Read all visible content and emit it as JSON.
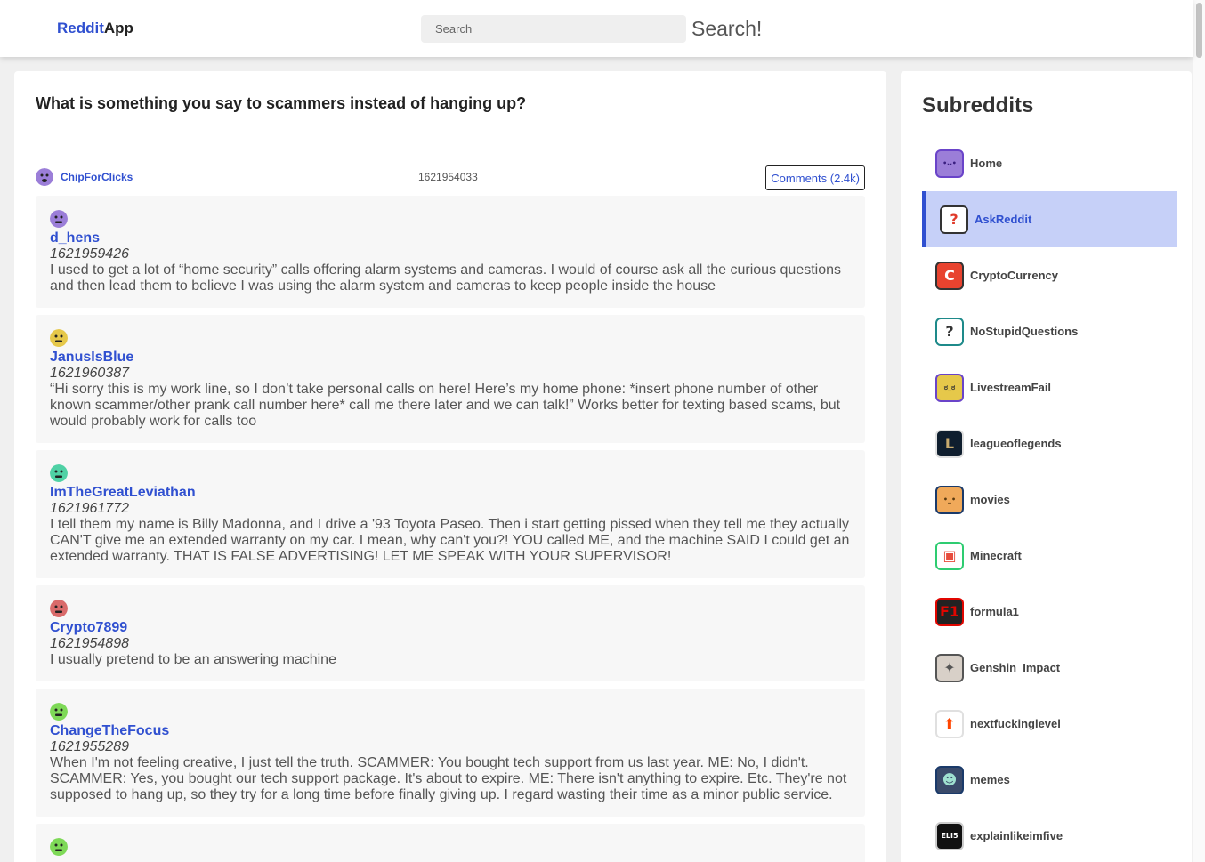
{
  "header": {
    "logo_part1": "Reddit",
    "logo_part2": "App",
    "search_placeholder": "Search",
    "search_button": "Search!"
  },
  "post": {
    "title": "What is something you say to scammers instead of hanging up?",
    "author": "ChipForClicks",
    "timestamp": "1621954033",
    "comments_label": "Comments (2.4k)",
    "author_avatar_color": "#9b7ed8"
  },
  "comments": [
    {
      "author": "d_hens",
      "timestamp": "1621959426",
      "body": "I used to get a lot of “home security” calls offering alarm systems and cameras. I would of course ask all the curious questions and then lead them to believe I was using the alarm system and cameras to keep people inside the house",
      "avatar_color": "#9b7ed8"
    },
    {
      "author": "JanusIsBlue",
      "timestamp": "1621960387",
      "body": "“Hi sorry this is my work line, so I don’t take personal calls on here! Here’s my home phone: *insert phone number of other known scammer/other prank call number here* call me there later and we can talk!” Works better for texting based scams, but would probably work for calls too",
      "avatar_color": "#e6c84a"
    },
    {
      "author": "ImTheGreatLeviathan",
      "timestamp": "1621961772",
      "body": "I tell them my name is Billy Madonna, and I drive a '93 Toyota Paseo. Then i start getting pissed when they tell me they actually CAN'T give me an extended warranty on my car. I mean, why can't you?! YOU called ME, and the machine SAID I could get an extended warranty. THAT IS FALSE ADVERTISING! LET ME SPEAK WITH YOUR SUPERVISOR!",
      "avatar_color": "#4fd1a5"
    },
    {
      "author": "Crypto7899",
      "timestamp": "1621954898",
      "body": "I usually pretend to be an answering machine",
      "avatar_color": "#d96a6a"
    },
    {
      "author": "ChangeTheFocus",
      "timestamp": "1621955289",
      "body": "When I'm not feeling creative, I just tell the truth. SCAMMER: You bought tech support from us last year. ME: No, I didn't. SCAMMER: Yes, you bought our tech support package. It's about to expire. ME: There isn't anything to expire. Etc. They're not supposed to hang up, so they try for a long time before finally giving up. I regard wasting their time as a minor public service.",
      "avatar_color": "#7ed957"
    },
    {
      "author": "",
      "timestamp": "",
      "body": "",
      "avatar_color": "#7ed957"
    }
  ],
  "sidebar": {
    "title": "Subreddits",
    "items": [
      {
        "label": "Home",
        "icon": "home-icon",
        "bg": "#9b7ed8",
        "border": "#6a44c9",
        "glyph": "•ᴗ•",
        "fg": "#3a1f80"
      },
      {
        "label": "AskReddit",
        "icon": "askreddit-icon",
        "bg": "#ffffff",
        "border": "#333333",
        "glyph": "?",
        "fg": "#e03a2a"
      },
      {
        "label": "CryptoCurrency",
        "icon": "cryptocurrency-icon",
        "bg": "#e8432f",
        "border": "#333333",
        "glyph": "C",
        "fg": "#ffffff"
      },
      {
        "label": "NoStupidQuestions",
        "icon": "nostupidquestions-icon",
        "bg": "#ffffff",
        "border": "#1e8a8a",
        "glyph": "?",
        "fg": "#333333"
      },
      {
        "label": "LivestreamFail",
        "icon": "livestreamfail-icon",
        "bg": "#e6c84a",
        "border": "#6a44c9",
        "glyph": "ಠ_ಠ",
        "fg": "#333333"
      },
      {
        "label": "leagueoflegends",
        "icon": "leagueoflegends-icon",
        "bg": "#0f1e2e",
        "border": "#e0e0e0",
        "glyph": "L",
        "fg": "#c8aa6e"
      },
      {
        "label": "movies",
        "icon": "movies-icon",
        "bg": "#f0a95a",
        "border": "#1a3a6a",
        "glyph": "•_•",
        "fg": "#5a3a10"
      },
      {
        "label": "Minecraft",
        "icon": "minecraft-icon",
        "bg": "#ffffff",
        "border": "#2ecc71",
        "glyph": "▣",
        "fg": "#e74c3c"
      },
      {
        "label": "formula1",
        "icon": "formula1-icon",
        "bg": "#222222",
        "border": "#e10600",
        "glyph": "F1",
        "fg": "#e10600"
      },
      {
        "label": "Genshin_Impact",
        "icon": "genshin-impact-icon",
        "bg": "#d8d0c8",
        "border": "#555555",
        "glyph": "✦",
        "fg": "#555555"
      },
      {
        "label": "nextfuckinglevel",
        "icon": "nextfuckinglevel-icon",
        "bg": "#ffffff",
        "border": "#e0e0e0",
        "glyph": "⬆",
        "fg": "#ff4500"
      },
      {
        "label": "memes",
        "icon": "memes-icon",
        "bg": "#3a4a6a",
        "border": "#1a3a6a",
        "glyph": "☻",
        "fg": "#9fe0d0"
      },
      {
        "label": "explainlikeimfive",
        "icon": "explainlikeimfive-icon",
        "bg": "#111111",
        "border": "#cccccc",
        "glyph": "ELI5",
        "fg": "#ffffff"
      }
    ],
    "active_index": 1
  }
}
